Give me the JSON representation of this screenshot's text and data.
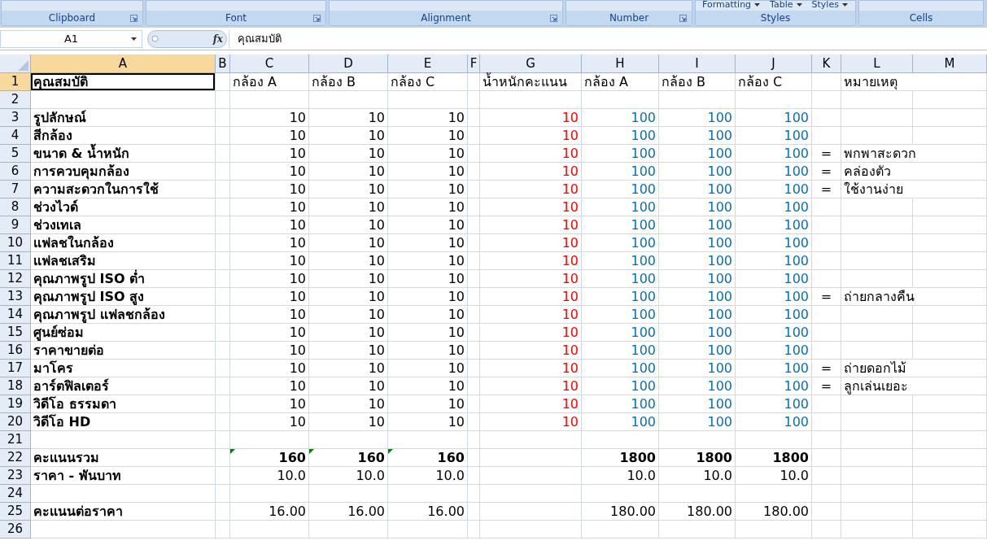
{
  "ribbon": {
    "groups": [
      {
        "label": "Clipboard",
        "launcher": true
      },
      {
        "label": "Font",
        "launcher": true
      },
      {
        "label": "Alignment",
        "launcher": true
      },
      {
        "label": "Number",
        "launcher": true
      },
      {
        "label": "Styles",
        "launcher": false,
        "buttons": [
          "Formatting",
          "Table",
          "Styles"
        ]
      },
      {
        "label": "Cells",
        "launcher": false
      }
    ]
  },
  "formula_bar": {
    "name_box": "A1",
    "fx": "fx",
    "formula": "คุณสมบัติ"
  },
  "columns": [
    {
      "label": "A",
      "kind": "label",
      "selected": true
    },
    {
      "label": "B",
      "kind": "gap",
      "selected": false
    },
    {
      "label": "C",
      "kind": "value",
      "selected": false
    },
    {
      "label": "D",
      "kind": "value",
      "selected": false
    },
    {
      "label": "E",
      "kind": "value",
      "selected": false
    },
    {
      "label": "F",
      "kind": "gap",
      "selected": false
    },
    {
      "label": "G",
      "kind": "weight",
      "selected": false
    },
    {
      "label": "H",
      "kind": "score",
      "selected": false
    },
    {
      "label": "I",
      "kind": "score",
      "selected": false
    },
    {
      "label": "J",
      "kind": "score",
      "selected": false
    },
    {
      "label": "K",
      "kind": "mark",
      "selected": false
    },
    {
      "label": "L",
      "kind": "note",
      "selected": false
    },
    {
      "label": "M",
      "kind": "gap",
      "selected": false
    }
  ],
  "rows": [
    {
      "number": "1",
      "kind": "header",
      "selected": true,
      "cells": {
        "A": "คุณสมบัติ",
        "C": "กล้อง A",
        "D": "กล้อง B",
        "E": "กล้อง C",
        "G": "น้ำหนักคะแนน",
        "H": "กล้อง A",
        "I": "กล้อง B",
        "J": "กล้อง C",
        "L": "หมายเหตุ"
      }
    },
    {
      "number": "2",
      "kind": "blank",
      "selected": false,
      "cells": {}
    },
    {
      "number": "3",
      "kind": "data",
      "selected": false,
      "cells": {
        "A": "รูปลักษณ์",
        "C": "10",
        "D": "10",
        "E": "10",
        "G": "10",
        "H": "100",
        "I": "100",
        "J": "100"
      }
    },
    {
      "number": "4",
      "kind": "data",
      "selected": false,
      "cells": {
        "A": "สีกล้อง",
        "C": "10",
        "D": "10",
        "E": "10",
        "G": "10",
        "H": "100",
        "I": "100",
        "J": "100"
      }
    },
    {
      "number": "5",
      "kind": "data",
      "selected": false,
      "cells": {
        "A": "ขนาด & น้ำหนัก",
        "C": "10",
        "D": "10",
        "E": "10",
        "G": "10",
        "H": "100",
        "I": "100",
        "J": "100",
        "K": "=",
        "L": "พกพาสะดวก"
      }
    },
    {
      "number": "6",
      "kind": "data",
      "selected": false,
      "cells": {
        "A": "การควบคุมกล้อง",
        "C": "10",
        "D": "10",
        "E": "10",
        "G": "10",
        "H": "100",
        "I": "100",
        "J": "100",
        "K": "=",
        "L": "คล่องตัว"
      }
    },
    {
      "number": "7",
      "kind": "data",
      "selected": false,
      "cells": {
        "A": "ความสะดวกในการใช้",
        "C": "10",
        "D": "10",
        "E": "10",
        "G": "10",
        "H": "100",
        "I": "100",
        "J": "100",
        "K": "=",
        "L": "ใช้งานง่าย"
      }
    },
    {
      "number": "8",
      "kind": "data",
      "selected": false,
      "cells": {
        "A": "ช่วงไวด์",
        "C": "10",
        "D": "10",
        "E": "10",
        "G": "10",
        "H": "100",
        "I": "100",
        "J": "100"
      }
    },
    {
      "number": "9",
      "kind": "data",
      "selected": false,
      "cells": {
        "A": "ช่วงเทเล",
        "C": "10",
        "D": "10",
        "E": "10",
        "G": "10",
        "H": "100",
        "I": "100",
        "J": "100"
      }
    },
    {
      "number": "10",
      "kind": "data",
      "selected": false,
      "cells": {
        "A": "แฟลชในกล้อง",
        "C": "10",
        "D": "10",
        "E": "10",
        "G": "10",
        "H": "100",
        "I": "100",
        "J": "100"
      }
    },
    {
      "number": "11",
      "kind": "data",
      "selected": false,
      "cells": {
        "A": "แฟลชเสริม",
        "C": "10",
        "D": "10",
        "E": "10",
        "G": "10",
        "H": "100",
        "I": "100",
        "J": "100"
      }
    },
    {
      "number": "12",
      "kind": "data",
      "selected": false,
      "cells": {
        "A": "คุณภาพรูป ISO ต่ำ",
        "C": "10",
        "D": "10",
        "E": "10",
        "G": "10",
        "H": "100",
        "I": "100",
        "J": "100"
      }
    },
    {
      "number": "13",
      "kind": "data",
      "selected": false,
      "cells": {
        "A": "คุณภาพรูป ISO สูง",
        "C": "10",
        "D": "10",
        "E": "10",
        "G": "10",
        "H": "100",
        "I": "100",
        "J": "100",
        "K": "=",
        "L": "ถ่ายกลางคืน"
      }
    },
    {
      "number": "14",
      "kind": "data",
      "selected": false,
      "cells": {
        "A": "คุณภาพรูป แฟลชกล้อง",
        "C": "10",
        "D": "10",
        "E": "10",
        "G": "10",
        "H": "100",
        "I": "100",
        "J": "100"
      }
    },
    {
      "number": "15",
      "kind": "data",
      "selected": false,
      "cells": {
        "A": "ศูนย์ซ่อม",
        "C": "10",
        "D": "10",
        "E": "10",
        "G": "10",
        "H": "100",
        "I": "100",
        "J": "100"
      }
    },
    {
      "number": "16",
      "kind": "data",
      "selected": false,
      "cells": {
        "A": "ราคาขายต่อ",
        "C": "10",
        "D": "10",
        "E": "10",
        "G": "10",
        "H": "100",
        "I": "100",
        "J": "100"
      }
    },
    {
      "number": "17",
      "kind": "data",
      "selected": false,
      "cells": {
        "A": "มาโคร",
        "C": "10",
        "D": "10",
        "E": "10",
        "G": "10",
        "H": "100",
        "I": "100",
        "J": "100",
        "K": "=",
        "L": "ถ่ายดอกไม้"
      }
    },
    {
      "number": "18",
      "kind": "data",
      "selected": false,
      "cells": {
        "A": "อาร์ตฟิลเตอร์",
        "C": "10",
        "D": "10",
        "E": "10",
        "G": "10",
        "H": "100",
        "I": "100",
        "J": "100",
        "K": "=",
        "L": "ลูกเล่นเยอะ"
      }
    },
    {
      "number": "19",
      "kind": "data",
      "selected": false,
      "cells": {
        "A": "วิดีโอ ธรรมดา",
        "C": "10",
        "D": "10",
        "E": "10",
        "G": "10",
        "H": "100",
        "I": "100",
        "J": "100"
      }
    },
    {
      "number": "20",
      "kind": "data",
      "selected": false,
      "cells": {
        "A": "วิดีโอ HD",
        "C": "10",
        "D": "10",
        "E": "10",
        "G": "10",
        "H": "100",
        "I": "100",
        "J": "100"
      }
    },
    {
      "number": "21",
      "kind": "blank",
      "selected": false,
      "cells": {}
    },
    {
      "number": "22",
      "kind": "total",
      "selected": false,
      "cells": {
        "A": "คะแนนรวม",
        "C": "160",
        "D": "160",
        "E": "160",
        "H": "1800",
        "I": "1800",
        "J": "1800"
      },
      "flags": {
        "C": true,
        "D": true,
        "E": true
      }
    },
    {
      "number": "23",
      "kind": "summary",
      "selected": false,
      "cells": {
        "A": "ราคา - พันบาท",
        "C": "10.0",
        "D": "10.0",
        "E": "10.0",
        "H": "10.0",
        "I": "10.0",
        "J": "10.0"
      }
    },
    {
      "number": "24",
      "kind": "blank",
      "selected": false,
      "cells": {}
    },
    {
      "number": "25",
      "kind": "summary",
      "selected": false,
      "cells": {
        "A": "คะแนนต่อราคา",
        "C": "16.00",
        "D": "16.00",
        "E": "16.00",
        "H": "180.00",
        "I": "180.00",
        "J": "180.00"
      }
    },
    {
      "number": "26",
      "kind": "blank",
      "selected": false,
      "cells": {}
    }
  ]
}
